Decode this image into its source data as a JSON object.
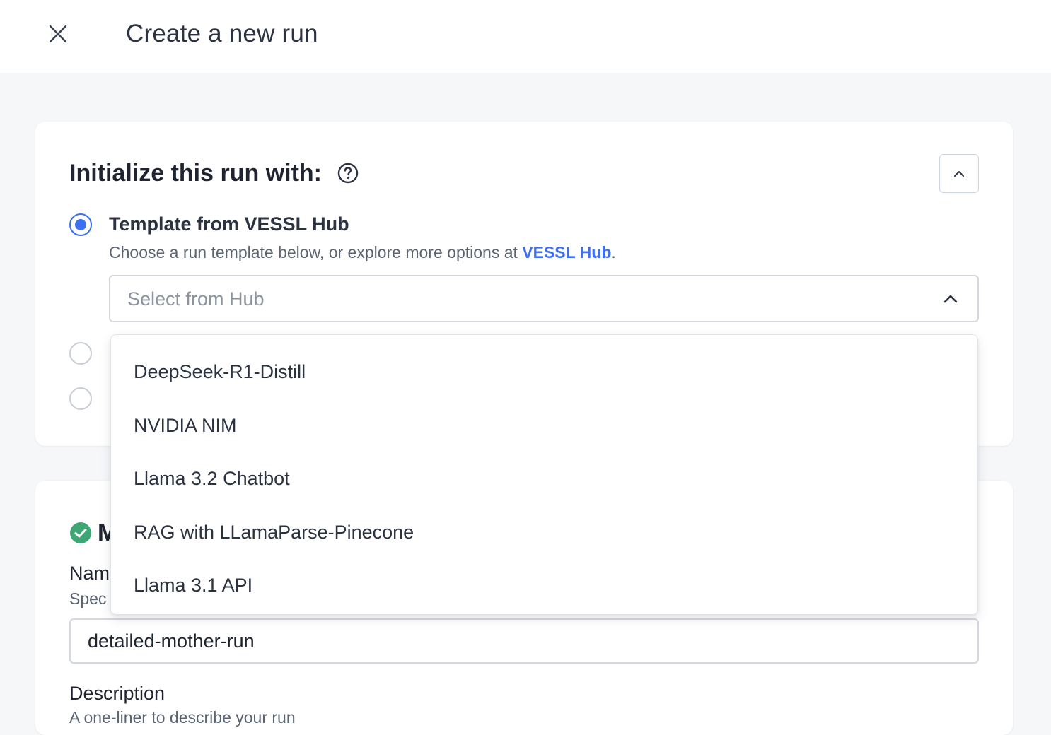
{
  "header": {
    "title": "Create a new run"
  },
  "init_section": {
    "title": "Initialize this run with:",
    "options": [
      {
        "label": "Template from VESSL Hub",
        "description_prefix": "Choose a run template below, or explore more options at ",
        "description_link": "VESSL Hub",
        "description_suffix": ".",
        "selected": true
      },
      {
        "selected": false
      },
      {
        "selected": false
      }
    ],
    "select": {
      "placeholder": "Select from Hub"
    },
    "dropdown_items": [
      "DeepSeek-R1-Distill",
      "NVIDIA NIM",
      "Llama 3.2 Chatbot",
      "RAG with LLamaParse-Pinecone",
      "Llama 3.1 API"
    ]
  },
  "metadata_section": {
    "title_fragment": "M",
    "name_label": "Nam",
    "name_help": "Spec",
    "name_value": "detailed-mother-run",
    "description_label": "Description",
    "description_help": "A one-liner to describe your run"
  },
  "colors": {
    "accent": "#3d6ff0",
    "success": "#3ea574",
    "text": "#1f2430",
    "muted": "#5b6472",
    "border": "#d3d8df",
    "background": "#f6f7f9"
  },
  "icons": {
    "close": "close-icon",
    "help": "help-circle-icon",
    "collapse": "chevron-up-icon",
    "select": "chevron-up-icon",
    "status": "check-circle-icon"
  }
}
